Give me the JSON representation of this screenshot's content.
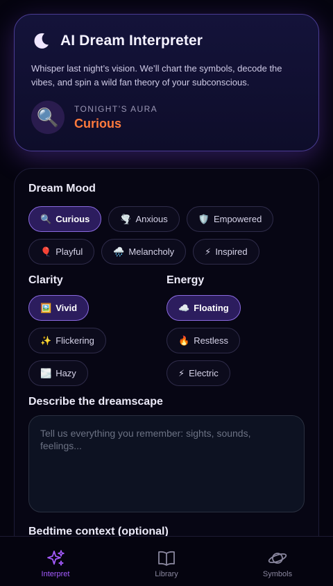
{
  "header": {
    "title": "AI Dream Interpreter",
    "icon": "crescent-moon-icon",
    "subtitle": "Whisper last night’s vision. We’ll chart the symbols, decode the vibes, and spin a wild fan theory of your subconscious.",
    "aura": {
      "emoji": "🔍",
      "label": "TONIGHT’S AURA",
      "value": "Curious",
      "value_color": "#ff7a3d"
    }
  },
  "mood": {
    "title": "Dream Mood",
    "selected": "Curious",
    "options": [
      {
        "emoji": "🔍",
        "label": "Curious"
      },
      {
        "emoji": "🌪️",
        "label": "Anxious"
      },
      {
        "emoji": "🛡️",
        "label": "Empowered"
      },
      {
        "emoji": "🎈",
        "label": "Playful"
      },
      {
        "emoji": "🌧️",
        "label": "Melancholy"
      },
      {
        "emoji": "⚡",
        "label": "Inspired"
      }
    ]
  },
  "clarity": {
    "title": "Clarity",
    "selected": "Vivid",
    "options": [
      {
        "emoji": "🖼️",
        "label": "Vivid"
      },
      {
        "emoji": "✨",
        "label": "Flickering"
      },
      {
        "emoji": "🌫️",
        "label": "Hazy"
      }
    ]
  },
  "energy": {
    "title": "Energy",
    "selected": "Floating",
    "options": [
      {
        "emoji": "☁️",
        "label": "Floating"
      },
      {
        "emoji": "🔥",
        "label": "Restless"
      },
      {
        "emoji": "⚡",
        "label": "Electric"
      }
    ]
  },
  "describe": {
    "title": "Describe the dreamscape",
    "value": "",
    "placeholder": "Tell us everything you remember: sights, sounds, feelings..."
  },
  "bedtime": {
    "title": "Bedtime context (optional)"
  },
  "nav": {
    "items": [
      {
        "label": "Interpret",
        "icon": "sparkles-icon",
        "active": true
      },
      {
        "label": "Library",
        "icon": "book-icon",
        "active": false
      },
      {
        "label": "Symbols",
        "icon": "planet-icon",
        "active": false
      }
    ]
  },
  "colors": {
    "accent": "#a55bff",
    "selected_chip_bg": "#2c1d5e",
    "selected_chip_border": "#8b6be0",
    "aura_value": "#ff7a3d"
  }
}
